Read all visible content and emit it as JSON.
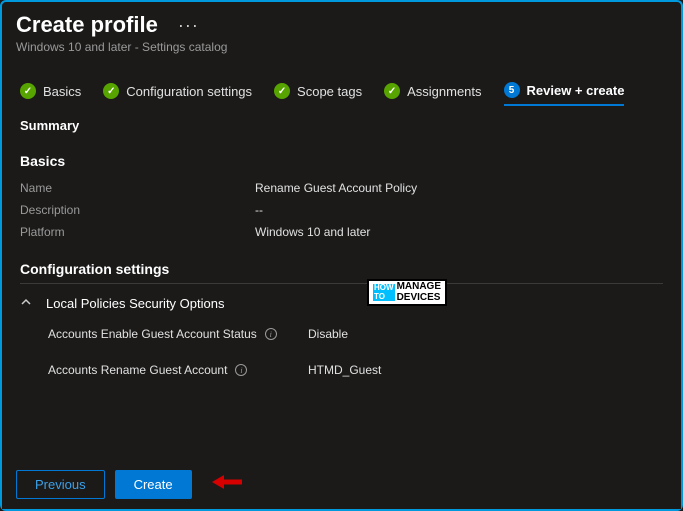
{
  "header": {
    "title": "Create profile",
    "subtitle": "Windows 10 and later - Settings catalog"
  },
  "steps": {
    "s1": "Basics",
    "s2": "Configuration settings",
    "s3": "Scope tags",
    "s4": "Assignments",
    "s5_num": "5",
    "s5": "Review + create"
  },
  "summary": {
    "label": "Summary",
    "basics_heading": "Basics",
    "name_k": "Name",
    "name_v": "Rename Guest Account Policy",
    "desc_k": "Description",
    "desc_v": "--",
    "platform_k": "Platform",
    "platform_v": "Windows 10 and later"
  },
  "config": {
    "heading": "Configuration settings",
    "group": "Local Policies Security Options",
    "set1_label": "Accounts Enable Guest Account Status",
    "set1_val": "Disable",
    "set2_label": "Accounts Rename Guest Account",
    "set2_val": "HTMD_Guest"
  },
  "footer": {
    "previous": "Previous",
    "create": "Create"
  },
  "watermark": {
    "how": "HOW\nTO",
    "txt": "MANAGE\nDEVICES"
  }
}
